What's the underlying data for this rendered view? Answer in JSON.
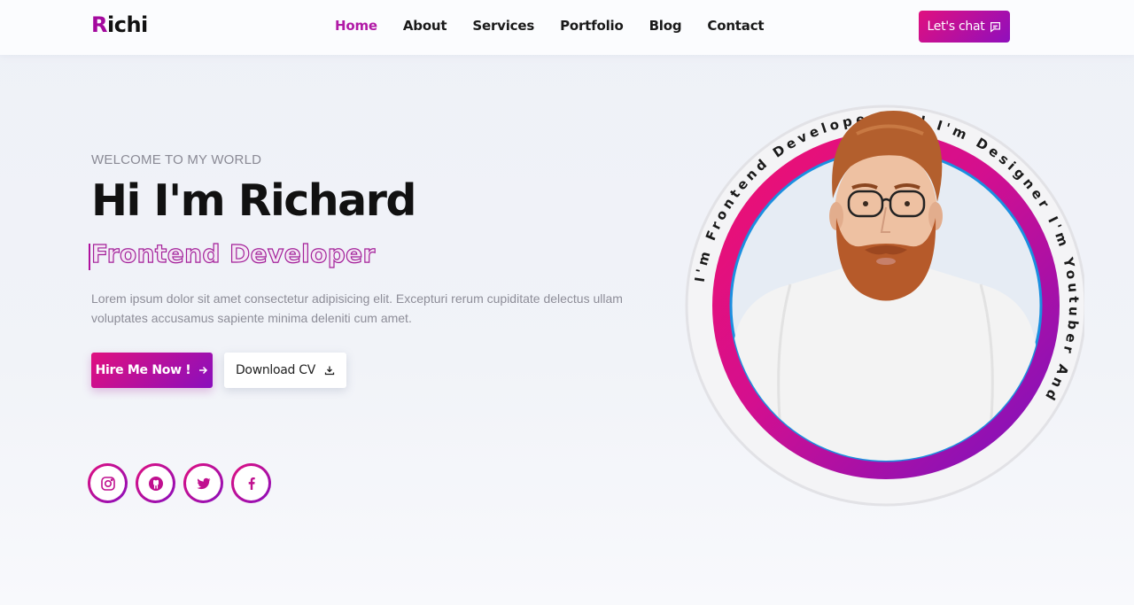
{
  "brand": {
    "logo_first_letter": "R",
    "logo_rest": "ichi",
    "accent_color": "#a4099e"
  },
  "nav": {
    "links": [
      {
        "label": "Home",
        "active": true
      },
      {
        "label": "About",
        "active": false
      },
      {
        "label": "Services",
        "active": false
      },
      {
        "label": "Portfolio",
        "active": false
      },
      {
        "label": "Blog",
        "active": false
      },
      {
        "label": "Contact",
        "active": false
      }
    ],
    "chat_label": "Let's chat",
    "chat_icon": "chat-bubble-icon"
  },
  "hero": {
    "welcome": "WELCOME TO MY WORLD",
    "title": "Hi I'm Richard",
    "role": "Frontend Developer",
    "intro": "Lorem ipsum dolor sit amet consectetur adipisicing elit. Excepturi rerum cupiditate delectus ullam voluptates accusamus sapiente minima deleniti cum amet.",
    "hire_label": "Hire Me Now !",
    "hire_icon": "arrow-right-icon",
    "cv_label": "Download CV",
    "cv_icon": "download-icon",
    "socials": [
      "instagram-icon",
      "github-icon",
      "twitter-icon",
      "facebook-icon"
    ],
    "ring_text": "I'm Frontend Developer And I'm Designer I'm Youtuber And ",
    "gradient_colors": [
      "#e0107f",
      "#8a0fbd"
    ]
  }
}
